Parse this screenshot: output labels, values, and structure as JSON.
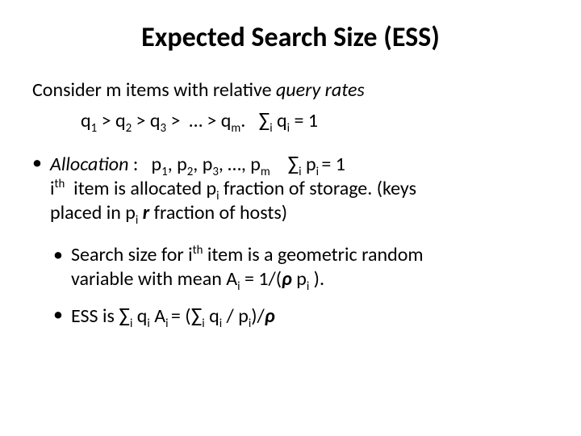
{
  "title": "Expected Search Size (ESS)",
  "intro_prefix": "Consider m items with relative ",
  "intro_italic": "query rates",
  "eq1_html": "q<sub>1</sub> > q<sub>2</sub> > q<sub>3</sub> > &nbsp;… > q<sub>m</sub>.&nbsp;&nbsp; <span class='sigma'>∑</span><sub>i</sub> q<sub>i</sub> = 1",
  "alloc_label": "Allocation",
  "alloc_line1_html": " :&nbsp;&nbsp; p<sub>1</sub>, p<sub>2</sub>, p<sub>3</sub>, …, p<sub>m</sub>&nbsp;&nbsp;&nbsp;&nbsp;<span class='sigma'>∑</span><sub>i</sub> p<sub>i </sub>= 1",
  "alloc_line2_html": "i<sup>th</sup>&nbsp; item is allocated p<sub>i</sub> fraction of storage. (keys",
  "alloc_line3_html": "placed in p<sub>i</sub> <span class='biti'>r</span> fraction of hosts)",
  "search_line1_html": "Search size for i<sup>th</sup> item is a geometric random",
  "search_line2_html": "variable with mean A<sub>i</sub> = 1/(<span class='biti'>ρ</span> p<sub>i</sub> ).",
  "ess_line_html": "ESS is <span class='sigma'>∑</span><sub>i</sub> q<sub>i</sub> A<sub>i </sub>= (<span class='sigma'>∑</span><sub>i</sub> q<sub>i</sub> / p<sub>i</sub>)/<span class='biti'>ρ</span>"
}
